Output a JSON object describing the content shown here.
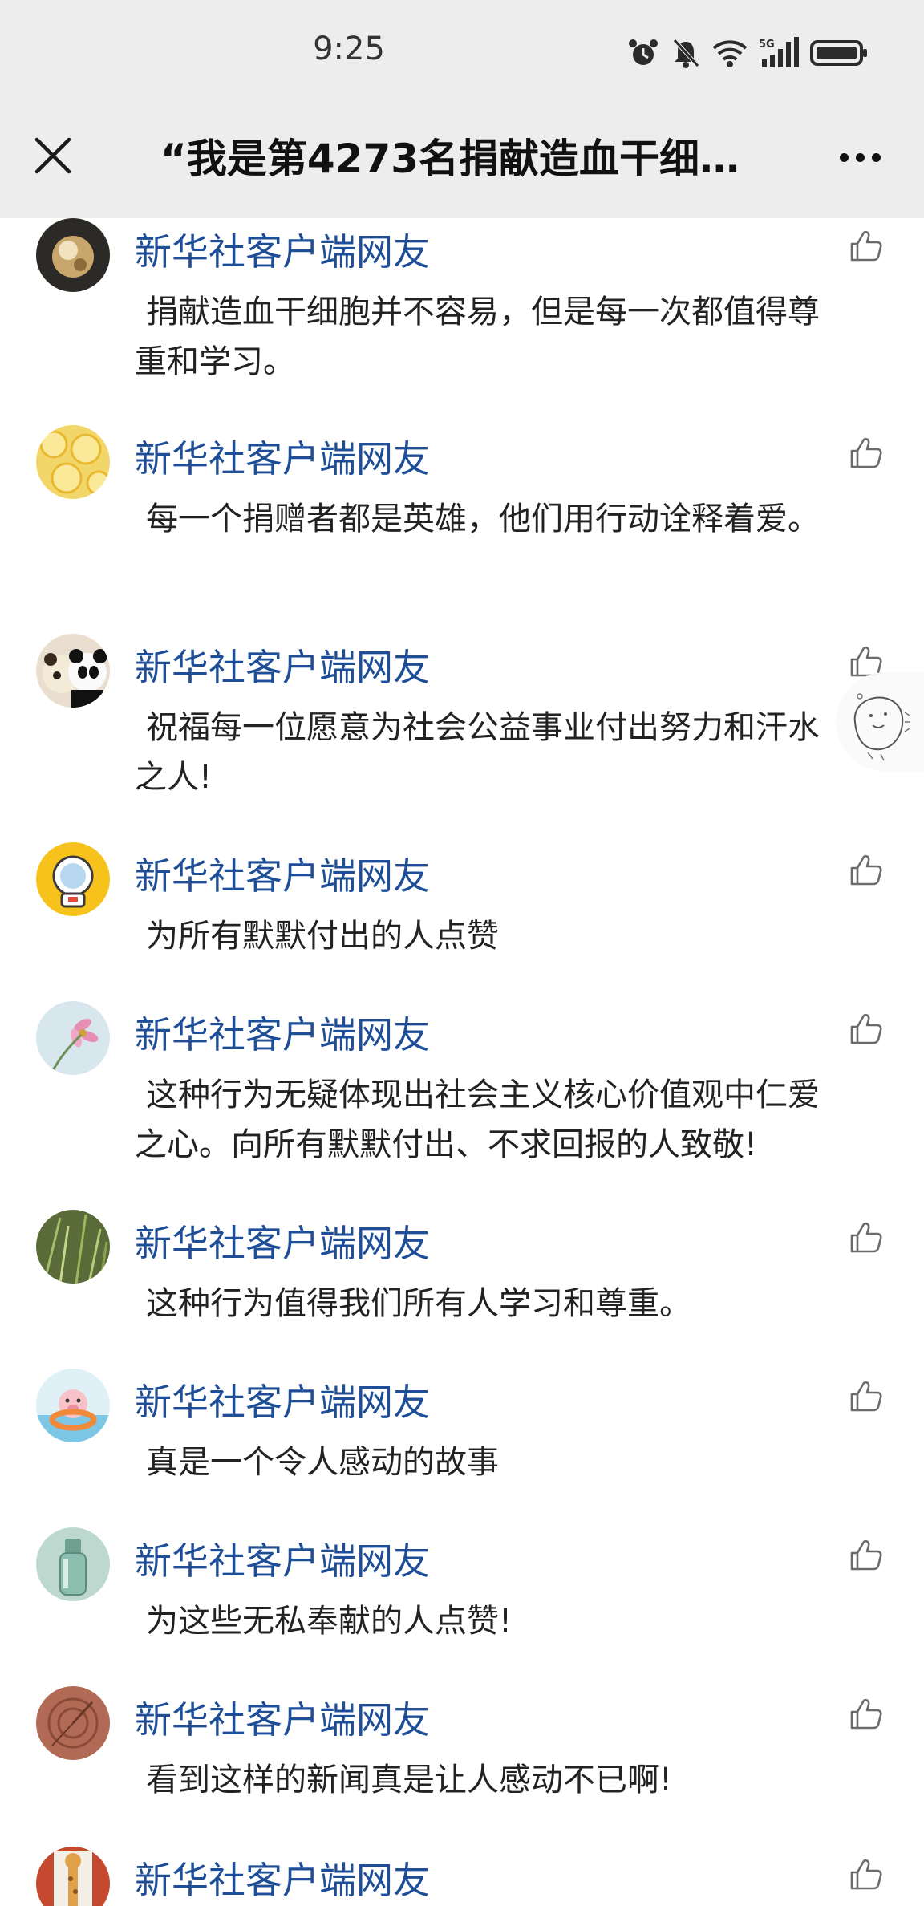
{
  "status_bar": {
    "time": "9:25",
    "network": "5G",
    "icons": [
      "alarm-icon",
      "mute-icon",
      "wifi-icon",
      "signal-icon",
      "battery-icon"
    ]
  },
  "nav": {
    "title": "“我是第4273名捐献造血干细…",
    "close_icon": "close-icon",
    "more_icon": "more-icon"
  },
  "colors": {
    "username": "#1f4e98",
    "bar_background": "#ededed",
    "text": "#222222"
  },
  "comments": [
    {
      "user": "新华社客户端网友",
      "text": "捐献造血干细胞并不容易，但是每一次都值得尊重和学习。",
      "avatar": "ball-avatar"
    },
    {
      "user": "新华社客户端网友",
      "text": "每一个捐赠者都是英雄，他们用行动诠释着爱。",
      "avatar": "lemon-avatar"
    },
    {
      "user": "新华社客户端网友",
      "text": "祝福每一位愿意为社会公益事业付出努力和汗水之人!",
      "avatar": "panda-avatar"
    },
    {
      "user": "新华社客户端网友",
      "text": "为所有默默付出的人点赞",
      "avatar": "astronaut-avatar"
    },
    {
      "user": "新华社客户端网友",
      "text": "这种行为无疑体现出社会主义核心价值观中仁爱之心。向所有默默付出、不求回报的人致敬!",
      "avatar": "flower-avatar"
    },
    {
      "user": "新华社客户端网友",
      "text": "这种行为值得我们所有人学习和尊重。",
      "avatar": "grass-avatar"
    },
    {
      "user": "新华社客户端网友",
      "text": "真是一个令人感动的故事",
      "avatar": "pig-avatar"
    },
    {
      "user": "新华社客户端网友",
      "text": "为这些无私奉献的人点赞!",
      "avatar": "bottle-avatar"
    },
    {
      "user": "新华社客户端网友",
      "text": "看到这样的新闻真是让人感动不已啊!",
      "avatar": "wood-avatar"
    },
    {
      "user": "新华社客户端网友",
      "text": "",
      "avatar": "giraffe-avatar"
    }
  ]
}
